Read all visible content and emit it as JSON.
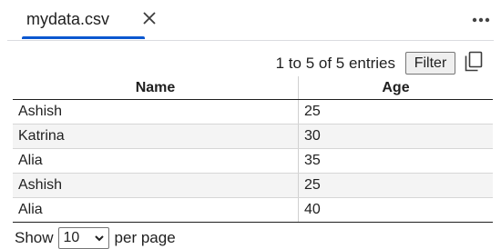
{
  "tab": {
    "title": "mydata.csv",
    "close_icon": "close-icon",
    "menu_icon": "more-horizontal-icon"
  },
  "table_toolbar": {
    "entries_text": "1 to 5 of 5 entries",
    "filter_label": "Filter",
    "copy_icon": "copy-icon"
  },
  "table": {
    "headers": [
      "Name",
      "Age"
    ],
    "rows": [
      [
        "Ashish",
        "25"
      ],
      [
        "Katrina",
        "30"
      ],
      [
        "Alia",
        "35"
      ],
      [
        "Ashish",
        "25"
      ],
      [
        "Alia",
        "40"
      ]
    ]
  },
  "footer": {
    "show_label": "Show",
    "page_size": "10",
    "per_page_label": "per page"
  },
  "colors": {
    "accent": "#0b57d0",
    "row_alt": "#f4f4f4"
  }
}
